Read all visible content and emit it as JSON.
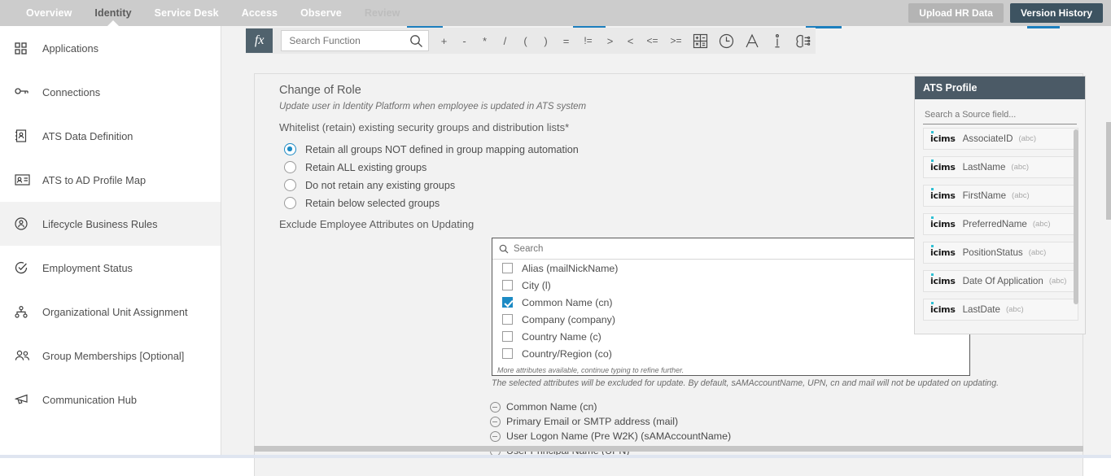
{
  "topnav": {
    "items": [
      {
        "label": "Overview",
        "state": "normal"
      },
      {
        "label": "Identity",
        "state": "active"
      },
      {
        "label": "Service Desk",
        "state": "normal"
      },
      {
        "label": "Access",
        "state": "normal"
      },
      {
        "label": "Observe",
        "state": "normal"
      },
      {
        "label": "Review",
        "state": "muted"
      }
    ],
    "upload_button": "Upload HR Data",
    "version_button": "Version History",
    "bg_color": "#cccccc",
    "primary_color": "#3d5361"
  },
  "sidebar": {
    "items": [
      {
        "label": "Applications",
        "icon": "grid-icon",
        "active": false
      },
      {
        "label": "Connections",
        "icon": "key-icon",
        "active": false
      },
      {
        "label": "ATS Data Definition",
        "icon": "contact-book-icon",
        "active": false
      },
      {
        "label": "ATS to AD Profile Map",
        "icon": "id-card-icon",
        "active": false
      },
      {
        "label": "Lifecycle Business Rules",
        "icon": "person-circle-icon",
        "active": true
      },
      {
        "label": "Employment Status",
        "icon": "check-circle-icon",
        "active": false
      },
      {
        "label": "Organizational Unit Assignment",
        "icon": "org-tree-icon",
        "active": false
      },
      {
        "label": "Group Memberships [Optional]",
        "icon": "people-icon",
        "active": false
      },
      {
        "label": "Communication Hub",
        "icon": "megaphone-icon",
        "active": false
      }
    ]
  },
  "formula_bar": {
    "fx_label": "fx",
    "search_placeholder": "Search Function",
    "search_value": "",
    "operators": [
      "+",
      "-",
      "*",
      "/",
      "(",
      ")",
      "=",
      "!=",
      ">",
      "<",
      "<=",
      ">="
    ],
    "tools": [
      {
        "name": "calculator-icon"
      },
      {
        "name": "clock-icon"
      },
      {
        "name": "text-icon"
      },
      {
        "name": "info-icon"
      },
      {
        "name": "ai-brain-icon"
      }
    ]
  },
  "card": {
    "title": "Change of Role",
    "subtitle": "Update user in Identity Platform when employee is updated in ATS system",
    "collapse_icon": "chevron-up-icon",
    "whitelist_label": "Whitelist (retain) existing security groups and distribution lists*",
    "radios": [
      {
        "label": "Retain all groups NOT defined in group mapping automation",
        "selected": true
      },
      {
        "label": "Retain ALL existing groups",
        "selected": false
      },
      {
        "label": "Do not retain any existing groups",
        "selected": false
      },
      {
        "label": "Retain below selected groups",
        "selected": false
      }
    ],
    "exclude_label": "Exclude Employee Attributes on Updating",
    "picker": {
      "search_placeholder": "Search",
      "search_value": "",
      "options": [
        {
          "label": "Alias (mailNickName)",
          "checked": false
        },
        {
          "label": "City (l)",
          "checked": false
        },
        {
          "label": "Common Name (cn)",
          "checked": true
        },
        {
          "label": "Company (company)",
          "checked": false
        },
        {
          "label": "Country Name (c)",
          "checked": false
        },
        {
          "label": "Country/Region (co)",
          "checked": false
        }
      ],
      "hint": "More attributes available, continue typing to refine further."
    },
    "note": "The selected attributes will be excluded for update. By default, sAMAccountName, UPN, cn and mail will not be updated on updating.",
    "selected_chips": [
      "Common Name (cn)",
      "Primary Email or SMTP address (mail)",
      "User Logon Name (Pre W2K) (sAMAccountName)",
      "User Principal Name (UPN)"
    ]
  },
  "ats_panel": {
    "title": "ATS Profile",
    "search_placeholder": "Search a Source field...",
    "search_value": "",
    "header_color": "#4b5a66",
    "brand": "icims",
    "fields": [
      {
        "name": "AssociateID",
        "type": "(abc)"
      },
      {
        "name": "LastName",
        "type": "(abc)"
      },
      {
        "name": "FirstName",
        "type": "(abc)"
      },
      {
        "name": "PreferredName",
        "type": "(abc)"
      },
      {
        "name": "PositionStatus",
        "type": "(abc)"
      },
      {
        "name": "Date Of Application",
        "type": "(abc)"
      },
      {
        "name": "LastDate",
        "type": "(abc)"
      }
    ]
  }
}
